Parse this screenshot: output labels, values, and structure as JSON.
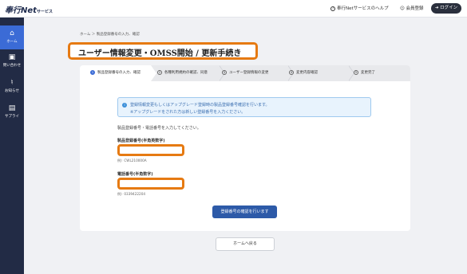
{
  "header": {
    "logo_text": "奉行Net",
    "logo_sub": "サービス",
    "help_label": "奉行Netサービスのヘルプ",
    "register_label": "会員登録",
    "login_label": "ログイン"
  },
  "sidebar": {
    "items": [
      {
        "label": "ホーム",
        "icon": "home-icon"
      },
      {
        "label": "問い合わせ",
        "icon": "chat-icon"
      },
      {
        "label": "お知らせ",
        "icon": "bell-icon"
      },
      {
        "label": "サプライ",
        "icon": "box-icon"
      }
    ]
  },
  "breadcrumb": "ホーム ＞ 製品登録番号の入力、確認",
  "page_title": "ユーザー情報変更・OMSS開始 / 更新手続き",
  "steps": [
    {
      "num": "1",
      "label": "製品登録番号の入力、確認"
    },
    {
      "num": "2",
      "label": "各種利用規約の確認、同意"
    },
    {
      "num": "3",
      "label": "ユーザー登録情報の変更"
    },
    {
      "num": "4",
      "label": "変更内容確認"
    },
    {
      "num": "5",
      "label": "変更完了"
    }
  ],
  "info": {
    "line1": "登録情報変更もしくはアップグレード登録時の製品登録番号確認を行います。",
    "line2": "※アップグレードをされた方は新しい登録番号を入力ください。"
  },
  "instruction": "製品登録番号・電話番号を入力してください。",
  "form": {
    "product_label": "製品登録番号(半角英数字)",
    "product_value": "",
    "product_example": "例）CWL210000A",
    "phone_label": "電話番号(半角数字)",
    "phone_value": "",
    "phone_example": "例）0339422204"
  },
  "confirm_button": "登録番号の確認を行います",
  "home_button": "ホームへ戻る",
  "colors": {
    "accent": "#3b6bd6",
    "sidebar": "#222b45",
    "highlight": "#e67a12"
  }
}
